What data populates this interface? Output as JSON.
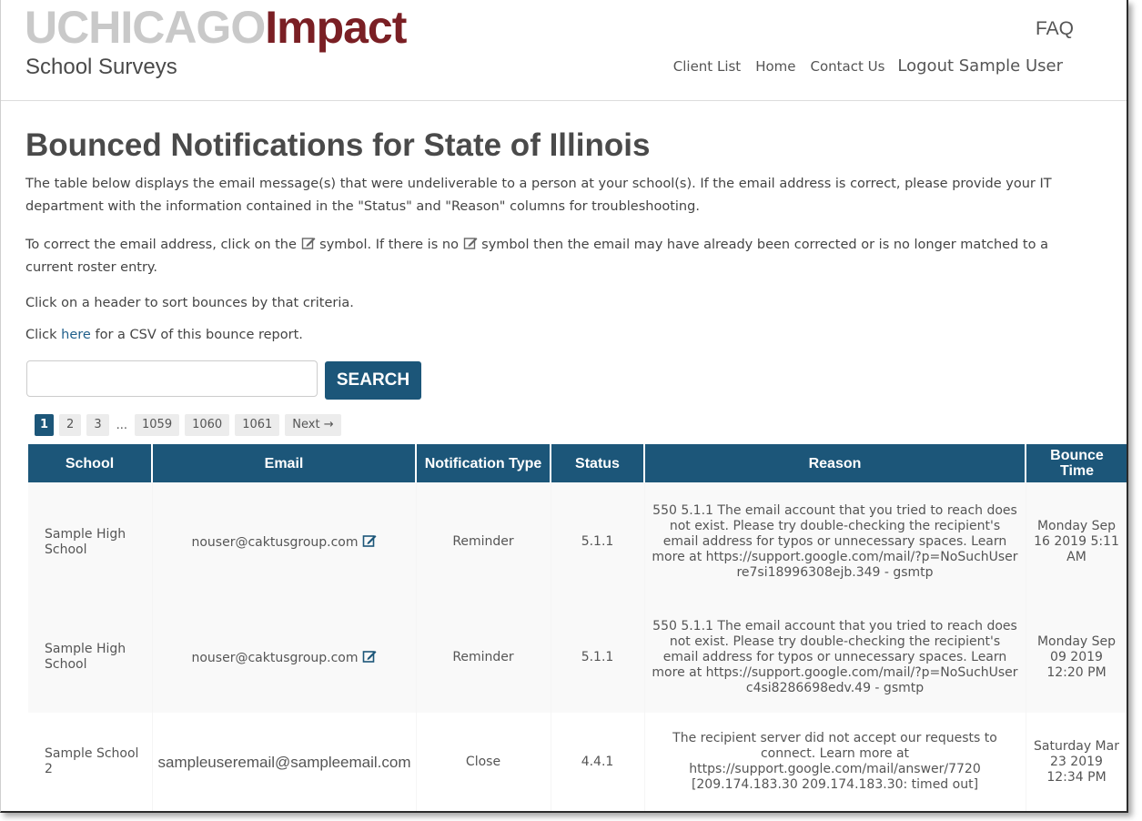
{
  "header": {
    "logo_part1": "UCHICAGO",
    "logo_part2": "Impact",
    "subtitle": "School Surveys",
    "faq": "FAQ",
    "nav": [
      "Client List",
      "Home",
      "Contact Us",
      "Logout Sample User"
    ]
  },
  "page": {
    "title": "Bounced Notifications for State of Illinois",
    "intro": "The table below displays the email message(s) that were undeliverable to a person at your school(s). If the email address is correct, please provide your IT department with the information contained in the \"Status\" and \"Reason\" columns for troubleshooting.",
    "correct_a": "To correct the email address, click on the",
    "correct_b": "symbol. If there is no",
    "correct_c": "symbol then the email may have already been corrected or is no longer matched to a current roster entry.",
    "sort_hint": "Click on a header to sort bounces by that criteria.",
    "csv_a": "Click",
    "csv_link": "here",
    "csv_b": "for a CSV of this bounce report."
  },
  "search": {
    "placeholder": "",
    "button": "SEARCH"
  },
  "pagination": {
    "pages": [
      "1",
      "2",
      "3"
    ],
    "ellipsis": "...",
    "last_pages": [
      "1059",
      "1060",
      "1061"
    ],
    "next": "Next →"
  },
  "table": {
    "headers": [
      "School",
      "Email",
      "Notification Type",
      "Status",
      "Reason",
      "Bounce Time"
    ],
    "rows": [
      {
        "school": "Sample High School",
        "email": "nouser@caktusgroup.com",
        "type": "Reminder",
        "status": "5.1.1",
        "reason": "550 5.1.1 The email account that you tried to reach does not exist. Please try double-checking the recipient's email address for typos or unnecessary spaces. Learn more at https://support.google.com/mail/?p=NoSuchUser re7si18996308ejb.349 - gsmtp",
        "bounce_time": "Monday Sep 16 2019 5:11 AM"
      },
      {
        "school": "Sample High School",
        "email": "nouser@caktusgroup.com",
        "type": "Reminder",
        "status": "5.1.1",
        "reason": "550 5.1.1 The email account that you tried to reach does not exist. Please try double-checking the recipient's email address for typos or unnecessary spaces. Learn more at https://support.google.com/mail/?p=NoSuchUser c4si8286698edv.49 - gsmtp",
        "bounce_time": "Monday Sep 09 2019 12:20 PM"
      },
      {
        "school": "Sample School 2",
        "email": "sampleuseremail@sampleemail.com",
        "type": "Close",
        "status": "4.4.1",
        "reason": "The recipient server did not accept our requests to connect. Learn more at https://support.google.com/mail/answer/7720 [209.174.183.30 209.174.183.30: timed out]",
        "bounce_time": "Saturday Mar 23 2019 12:34 PM"
      }
    ]
  },
  "colors": {
    "brand_dark": "#7a1f24",
    "brand_gray": "#c9c9c9",
    "table_header": "#1c5679",
    "link": "#1f5f8b"
  }
}
